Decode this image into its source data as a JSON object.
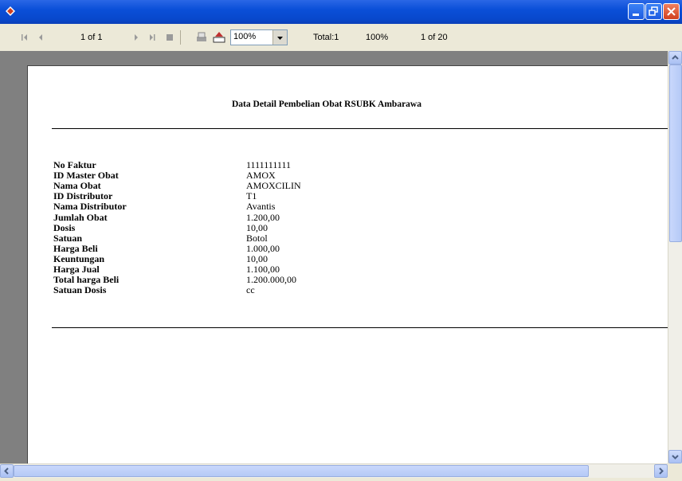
{
  "window": {
    "title": ""
  },
  "toolbar": {
    "page_indicator": "1 of 1",
    "zoom_value": "100%",
    "total": "Total:1",
    "percent": "100%",
    "record_count": "1 of 20"
  },
  "report": {
    "title": "Data Detail Pembelian Obat RSUBK Ambarawa",
    "fields": [
      {
        "label": "No Faktur",
        "value": "1111111111"
      },
      {
        "label": "ID Master Obat",
        "value": "AMOX"
      },
      {
        "label": "Nama Obat",
        "value": "AMOXCILIN"
      },
      {
        "label": "ID Distributor",
        "value": "T1"
      },
      {
        "label": "Nama Distributor",
        "value": "Avantis"
      },
      {
        "label": "Jumlah Obat",
        "value": "1.200,00"
      },
      {
        "label": "Dosis",
        "value": "10,00"
      },
      {
        "label": "Satuan",
        "value": "Botol"
      },
      {
        "label": "Harga Beli",
        "value": "1.000,00"
      },
      {
        "label": "Keuntungan",
        "value": "10,00"
      },
      {
        "label": "Harga Jual",
        "value": "1.100,00"
      },
      {
        "label": "Total harga Beli",
        "value": "1.200.000,00"
      },
      {
        "label": "Satuan  Dosis",
        "value": "cc"
      }
    ]
  },
  "colors": {
    "titlebar": "#0a4fd8",
    "viewport": "#808080",
    "paper": "#ffffff"
  }
}
